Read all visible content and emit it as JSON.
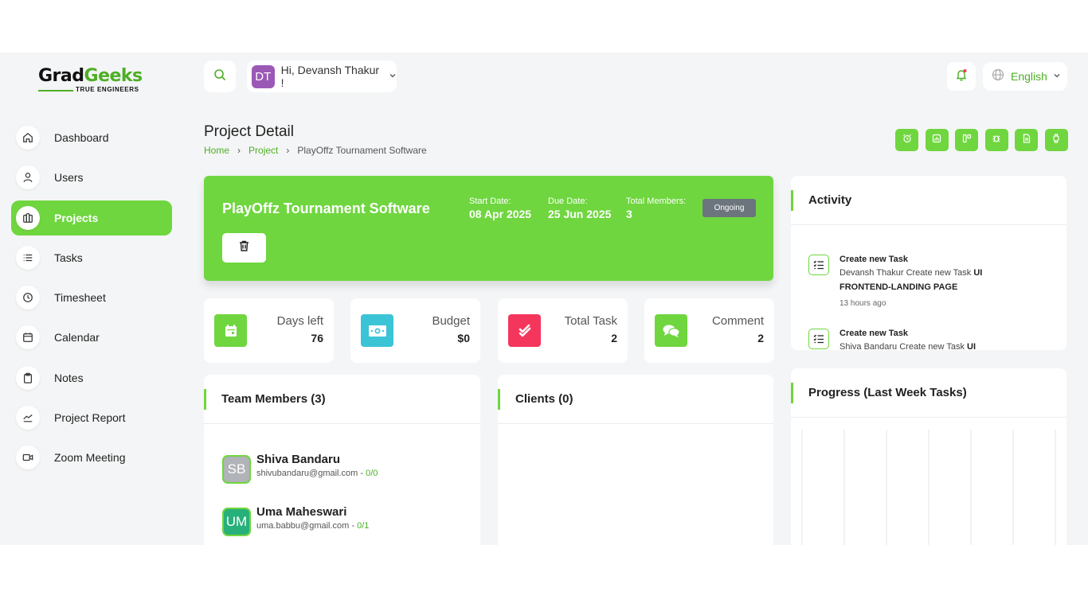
{
  "brand": {
    "name_part1": "Grad",
    "name_part2": "Geeks",
    "tagline": "TRUE ENGINEERS",
    "accent": "#6fd63f",
    "accent_dark": "#4caf25"
  },
  "header": {
    "user_initials": "DT",
    "greeting": "Hi, Devansh Thakur !",
    "language": "English"
  },
  "sidebar": {
    "items": [
      {
        "label": "Dashboard",
        "icon": "home-icon"
      },
      {
        "label": "Users",
        "icon": "user-icon"
      },
      {
        "label": "Projects",
        "icon": "projects-icon",
        "active": true
      },
      {
        "label": "Tasks",
        "icon": "list-icon"
      },
      {
        "label": "Timesheet",
        "icon": "clock-icon"
      },
      {
        "label": "Calendar",
        "icon": "calendar-icon"
      },
      {
        "label": "Notes",
        "icon": "clipboard-icon"
      },
      {
        "label": "Project Report",
        "icon": "chart-line-icon"
      },
      {
        "label": "Zoom Meeting",
        "icon": "video-icon"
      }
    ]
  },
  "page": {
    "title": "Project Detail",
    "breadcrumb": [
      "Home",
      "Project",
      "PlayOffz Tournament Software"
    ],
    "toolbar_icons": [
      "alarm-icon",
      "bar-chart-icon",
      "board-icon",
      "bug-icon",
      "file-icon",
      "watch-icon"
    ]
  },
  "project": {
    "name": "PlayOffz Tournament Software",
    "start_label": "Start Date:",
    "start_value": "08 Apr 2025",
    "due_label": "Due Date:",
    "due_value": "25 Jun 2025",
    "members_label": "Total Members:",
    "members_value": "3",
    "status": "Ongoing"
  },
  "stats": [
    {
      "label": "Days left",
      "value": "76",
      "color": "#6fd63f",
      "icon": "calendar-icon"
    },
    {
      "label": "Budget",
      "value": "$0",
      "color": "#3bc4d6",
      "icon": "money-icon"
    },
    {
      "label": "Total Task",
      "value": "2",
      "color": "#f5365c",
      "icon": "check-icon"
    },
    {
      "label": "Comment",
      "value": "2",
      "color": "#6fd63f",
      "icon": "comment-icon"
    }
  ],
  "team": {
    "title": "Team Members (3)",
    "members": [
      {
        "initials": "SB",
        "name": "Shiva Bandaru",
        "email": "shivubandaru@gmail.com",
        "sep": " - ",
        "count": "0/0",
        "color": "#b0b3b7"
      },
      {
        "initials": "UM",
        "name": "Uma Maheswari",
        "email": "uma.babbu@gmail.com",
        "sep": " - ",
        "count": "0/1",
        "color": "#27b07a"
      }
    ]
  },
  "clients": {
    "title": "Clients (0)"
  },
  "activity": {
    "title": "Activity",
    "items": [
      {
        "title": "Create new Task",
        "desc_prefix": "Devansh Thakur Create new Task ",
        "desc_bold": "UI FRONTEND-LANDING PAGE",
        "time": "13 hours ago"
      },
      {
        "title": "Create new Task",
        "desc_prefix": "Shiva Bandaru Create new Task ",
        "desc_bold": "UI",
        "time": ""
      }
    ]
  },
  "progress": {
    "title": "Progress (Last Week Tasks)"
  }
}
